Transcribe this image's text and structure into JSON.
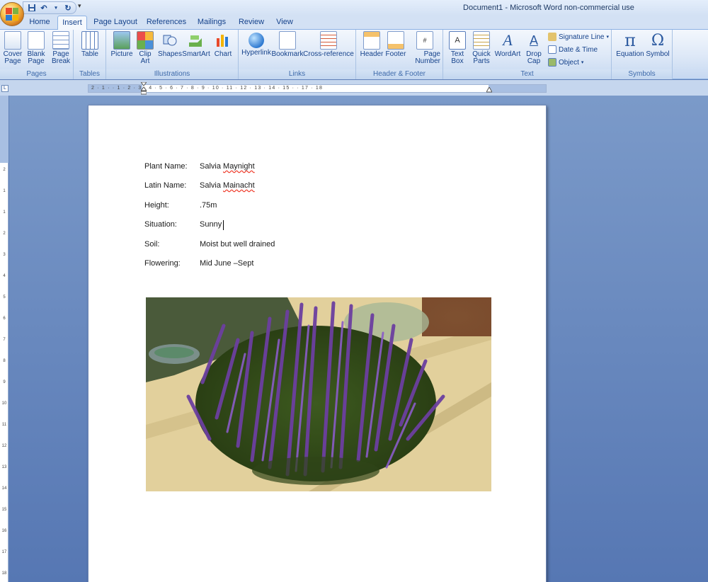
{
  "window": {
    "title": "Document1 - Microsoft Word non-commercial use"
  },
  "tabs": [
    {
      "label": "Home"
    },
    {
      "label": "Insert"
    },
    {
      "label": "Page Layout"
    },
    {
      "label": "References"
    },
    {
      "label": "Mailings"
    },
    {
      "label": "Review"
    },
    {
      "label": "View"
    }
  ],
  "ribbon": {
    "pages": {
      "label": "Pages",
      "cover_page": "Cover Page",
      "blank_page": "Blank Page",
      "page_break": "Page Break"
    },
    "tables": {
      "label": "Tables",
      "table": "Table"
    },
    "illustrations": {
      "label": "Illustrations",
      "picture": "Picture",
      "clip_art": "Clip Art",
      "shapes": "Shapes",
      "smartart": "SmartArt",
      "chart": "Chart"
    },
    "links": {
      "label": "Links",
      "hyperlink": "Hyperlink",
      "bookmark": "Bookmark",
      "cross_reference": "Cross-reference"
    },
    "header_footer": {
      "label": "Header & Footer",
      "header": "Header",
      "footer": "Footer",
      "page_number": "Page Number"
    },
    "text": {
      "label": "Text",
      "text_box": "Text Box",
      "quick_parts": "Quick Parts",
      "wordart": "WordArt",
      "drop_cap": "Drop Cap",
      "signature_line": "Signature Line",
      "date_time": "Date & Time",
      "object": "Object"
    },
    "symbols": {
      "label": "Symbols",
      "equation": "Equation",
      "symbol": "Symbol"
    }
  },
  "ruler": {
    "corner": "L",
    "h_numbers": "2 · 1 ·        · 1 · 2 · 3 · 4 · 5 · 6 · 7 · 8 · 9 · 10 · 11 · 12 · 13 · 14 · 15 ·      · 17 · 18",
    "v_numbers": "2\n\n\n1\n\n\n1\n\n\n2\n\n\n3\n\n\n4\n\n\n5\n\n\n6\n\n\n7\n\n\n8\n\n\n9\n\n\n10\n\n\n11\n\n\n12\n\n\n13\n\n\n14\n\n\n15\n\n\n16\n\n\n17\n\n\n18\n\n\n19"
  },
  "document": {
    "fields": [
      {
        "label": "Plant Name:",
        "value_plain": "Salvia ",
        "value_marked": "Maynight"
      },
      {
        "label": "Latin Name:",
        "value_plain": "Salvia ",
        "value_marked": "Mainacht"
      },
      {
        "label": "Height:",
        "value_plain": ".75m",
        "value_marked": ""
      },
      {
        "label": "Situation:",
        "value_plain": "Sunny",
        "value_marked": ""
      },
      {
        "label": "Soil:",
        "value_plain": "Moist but well drained",
        "value_marked": ""
      },
      {
        "label": "Flowering:",
        "value_plain": "Mid June –Sept",
        "value_marked": ""
      }
    ]
  },
  "colors": {
    "accent": "#15428b",
    "ribbon_bg": "#dde8f7",
    "workspace": "#6a8cc4",
    "spell_error": "#e32222"
  },
  "icons": {
    "office_button": "office-logo-icon",
    "save": "save-icon",
    "undo": "undo-icon",
    "redo": "redo-icon"
  }
}
